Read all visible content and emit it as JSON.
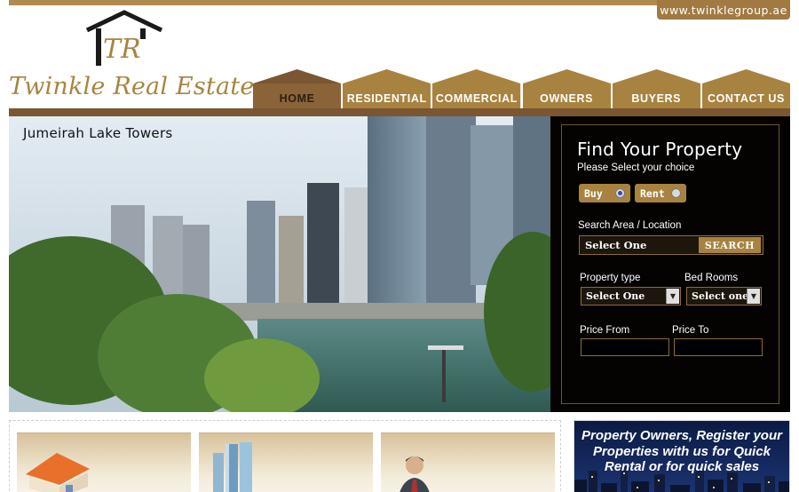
{
  "header": {
    "url_tab": "www.twinklegroup.ae",
    "logo": {
      "monogram": "TR",
      "name": "Twinkle Real Estate"
    }
  },
  "nav": {
    "items": [
      {
        "label": "HOME",
        "active": true
      },
      {
        "label": "RESIDENTIAL",
        "active": false
      },
      {
        "label": "COMMERCIAL",
        "active": false
      },
      {
        "label": "OWNERS",
        "active": false
      },
      {
        "label": "BUYERS",
        "active": false
      },
      {
        "label": "CONTACT US",
        "active": false
      }
    ]
  },
  "hero": {
    "caption": "Jumeirah Lake Towers"
  },
  "search": {
    "title": "Find Your Property",
    "subtitle": "Please Select your choice",
    "buy_label": "Buy",
    "rent_label": "Rent",
    "buy_selected": true,
    "location_label": "Search Area / Location",
    "location_value": "Select One",
    "search_button": "SEARCH",
    "property_type_label": "Property type",
    "property_type_value": "Select One",
    "bedrooms_label": "Bed Rooms",
    "bedrooms_value": "Select one",
    "price_from_label": "Price From",
    "price_to_label": "Price To",
    "price_from_value": "",
    "price_to_value": ""
  },
  "promo": {
    "owners_text_line1": "Property Owners, Register your",
    "owners_text_line2": "Properties with us for Quick",
    "owners_text_line3": "Rental or for quick sales"
  },
  "colors": {
    "gold": "#a8833f",
    "brown": "#7a5732",
    "panel_bg": "#040302",
    "owners_bg": "#0a1a44"
  }
}
